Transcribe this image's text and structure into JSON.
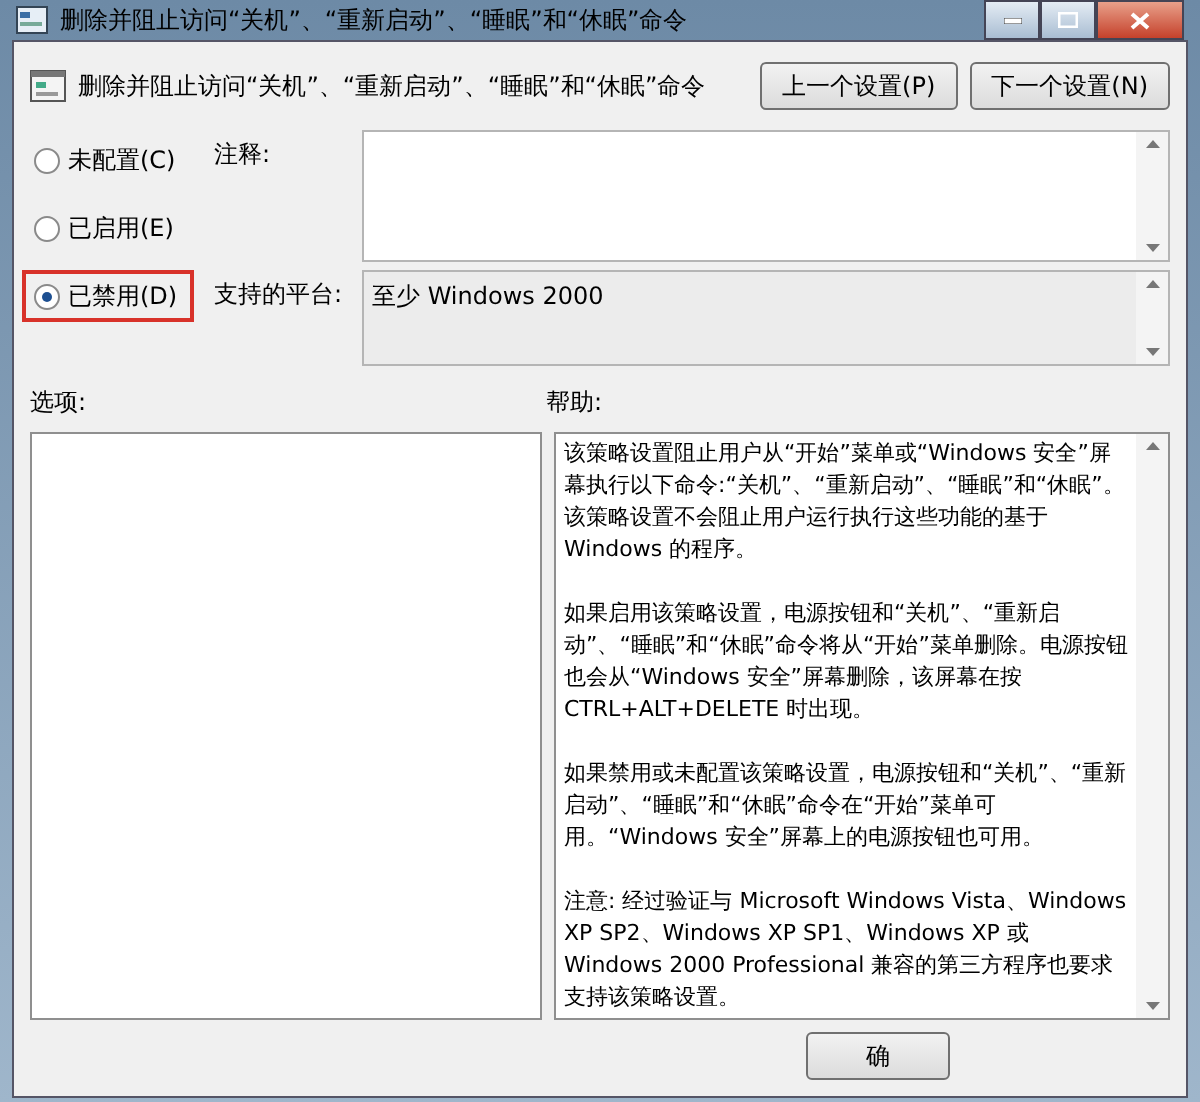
{
  "window": {
    "title": "删除并阻止访问“关机”、“重新启动”、“睡眠”和“休眠”命令"
  },
  "header": {
    "policy_name": "删除并阻止访问“关机”、“重新启动”、“睡眠”和“休眠”命令",
    "buttons": [
      "上一个设置(P)",
      "下一个设置(N)"
    ]
  },
  "states": [
    {
      "label": "未配置(C)",
      "selected": false,
      "highlighted": false
    },
    {
      "label": "已启用(E)",
      "selected": false,
      "highlighted": false
    },
    {
      "label": "已禁用(D)",
      "selected": true,
      "highlighted": true
    }
  ],
  "comment": {
    "label": "注释:"
  },
  "platform": {
    "label": "支持的平台:",
    "value": "至少 Windows 2000"
  },
  "options": {
    "label": "选项:"
  },
  "help": {
    "label": "帮助:",
    "paragraphs": [
      "该策略设置阻止用户从“开始”菜单或“Windows 安全”屏幕执行以下命令:“关机”、“重新启动”、“睡眠”和“休眠”。该策略设置不会阻止用户运行执行这些功能的基于 Windows 的程序。",
      "如果启用该策略设置，电源按钮和“关机”、“重新启动”、“睡眠”和“休眠”命令将从“开始”菜单删除。电源按钮也会从“Windows 安全”屏幕删除，该屏幕在按 CTRL+ALT+DELETE 时出现。",
      "如果禁用或未配置该策略设置，电源按钮和“关机”、“重新启动”、“睡眠”和“休眠”命令在“开始”菜单可用。“Windows 安全”屏幕上的电源按钮也可用。",
      "注意: 经过验证与 Microsoft Windows Vista、Windows XP SP2、Windows XP SP1、Windows XP 或 Windows 2000 Professional 兼容的第三方程序也要求支持该策略设置。"
    ]
  },
  "footer": {
    "buttons": [
      "确"
    ]
  }
}
